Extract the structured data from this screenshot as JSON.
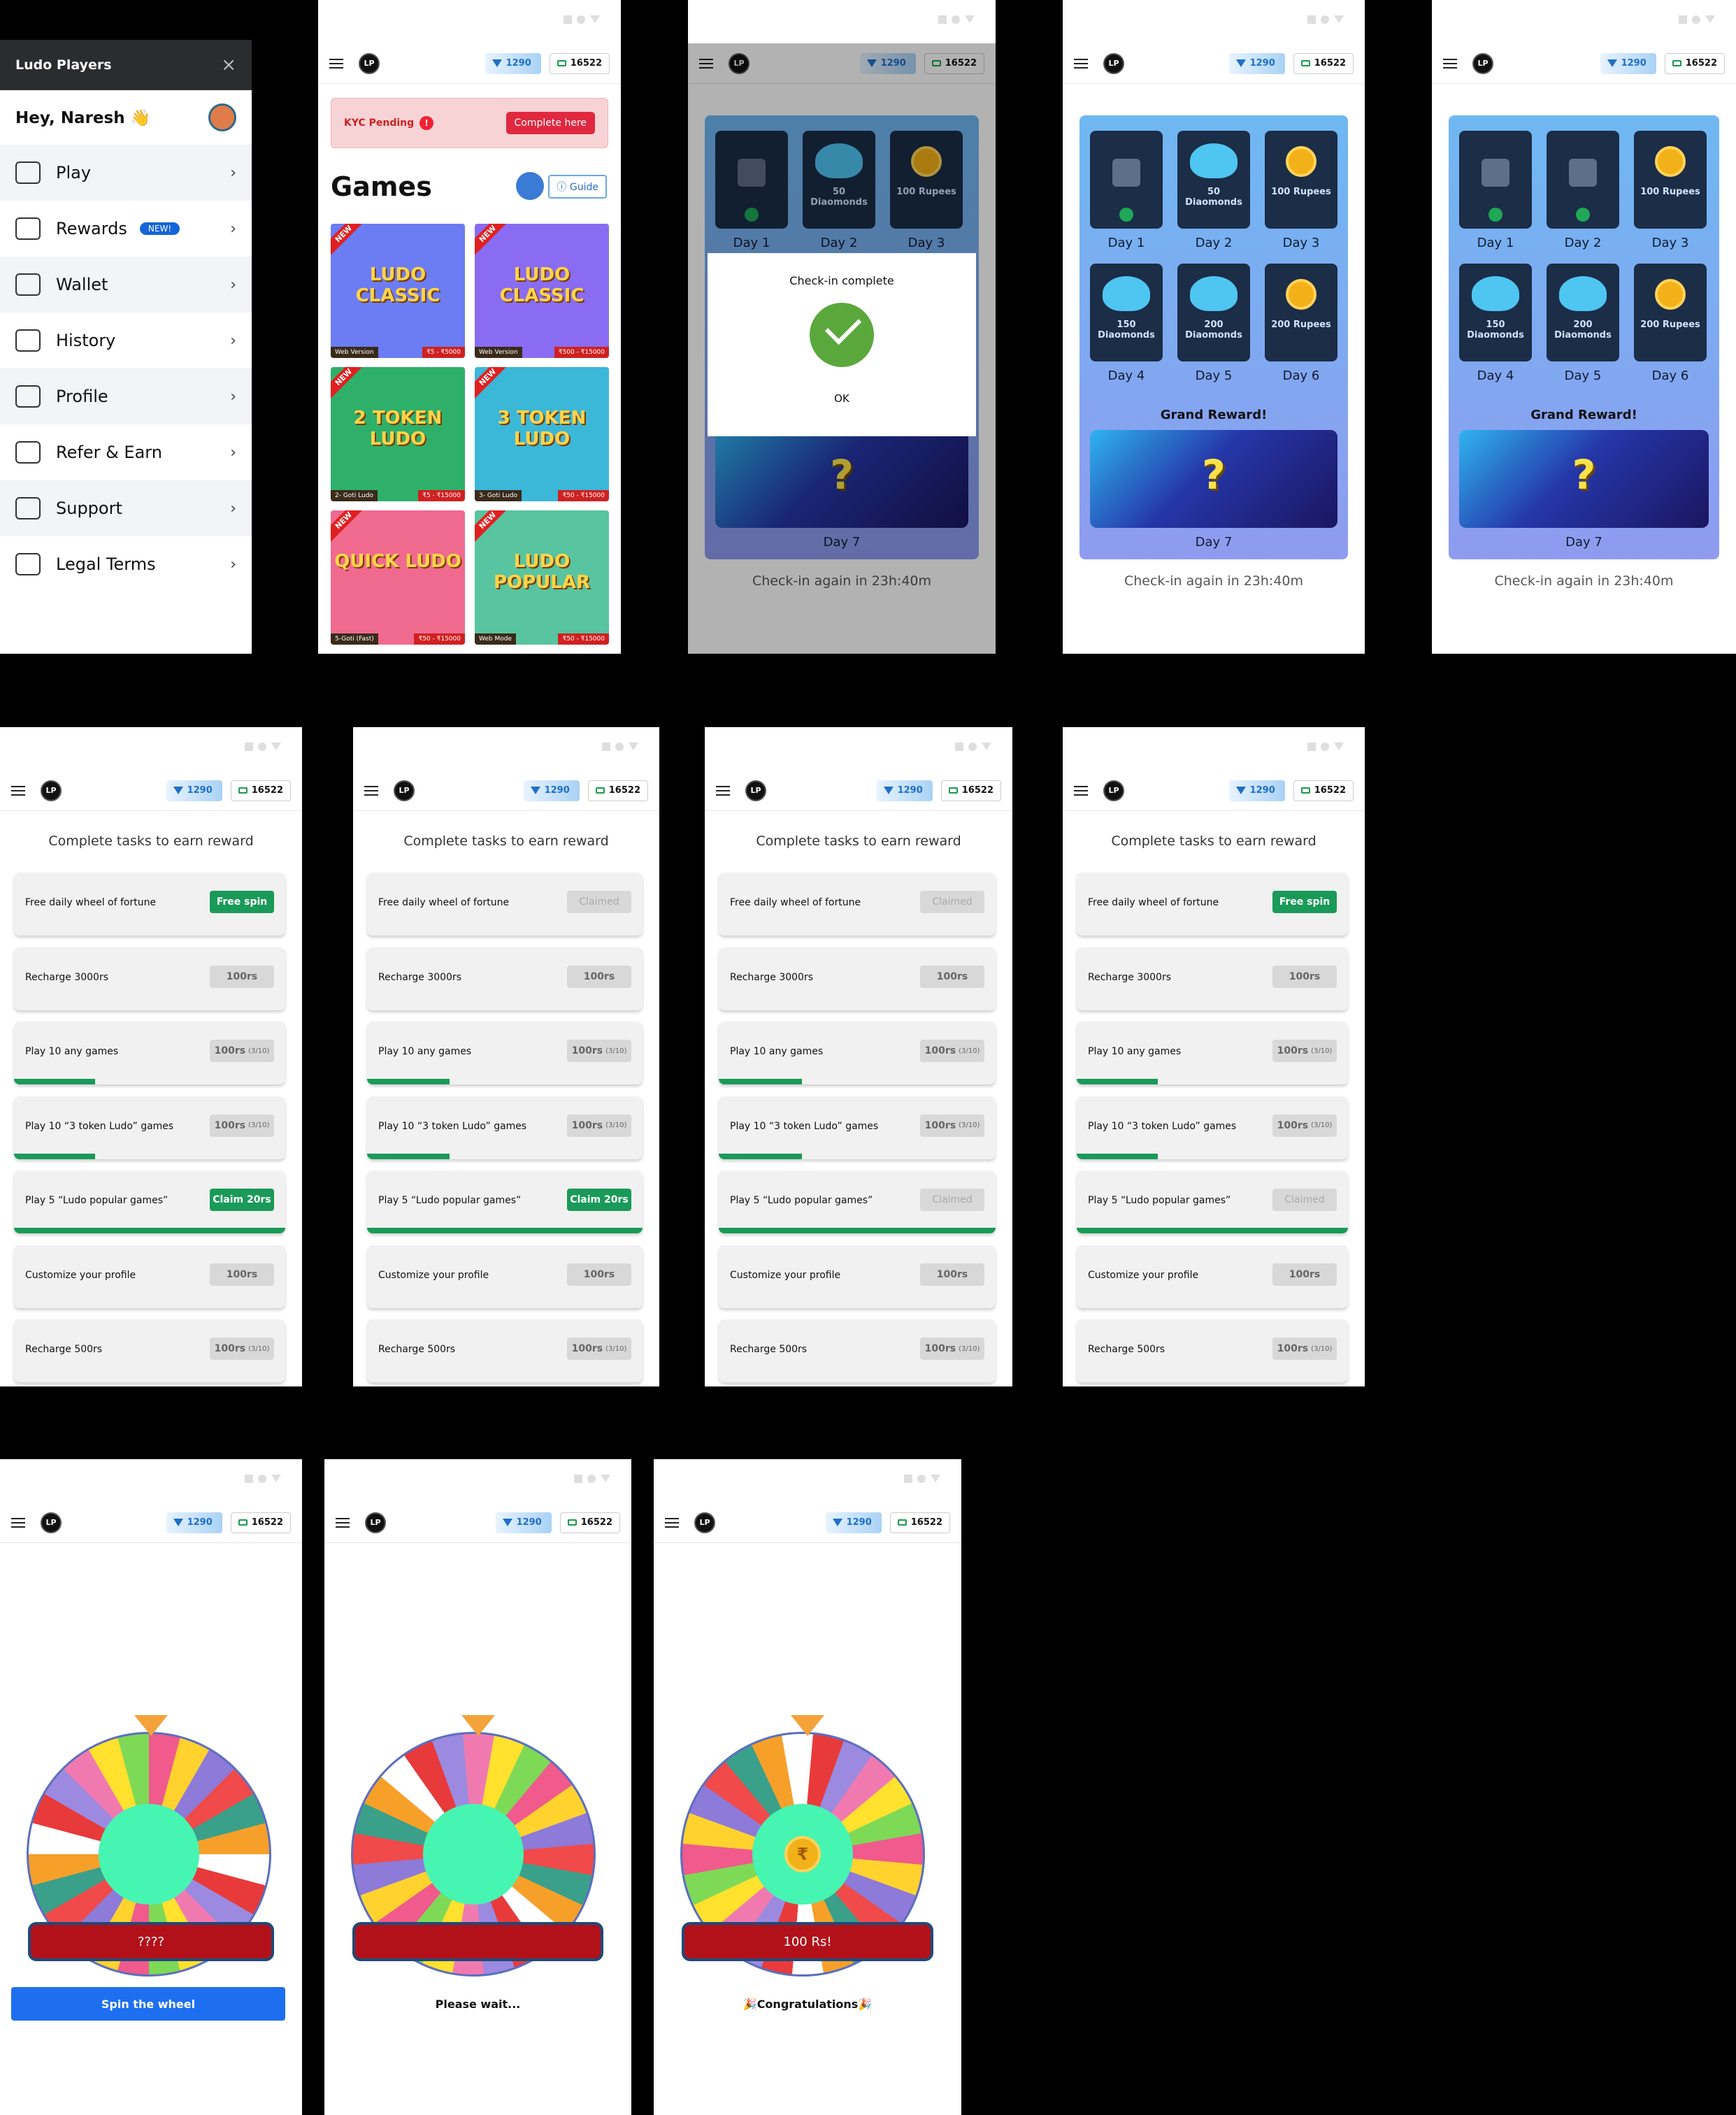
{
  "wallet": {
    "diamonds": "1290",
    "cash": "16522",
    "logo": "LP"
  },
  "drawer": {
    "title": "Ludo Players",
    "close": "×",
    "greeting": "Hey, Naresh",
    "wave": "👋",
    "items": [
      {
        "label": "Play",
        "icon": "dice-icon"
      },
      {
        "label": "Rewards",
        "icon": "gift-icon",
        "badge": "NEW!"
      },
      {
        "label": "Wallet",
        "icon": "wallet-icon"
      },
      {
        "label": "History",
        "icon": "clock-icon"
      },
      {
        "label": "Profile",
        "icon": "user-icon"
      },
      {
        "label": "Refer & Earn",
        "icon": "trophy-icon"
      },
      {
        "label": "Support",
        "icon": "headset-icon"
      },
      {
        "label": "Legal Terms",
        "icon": "document-icon"
      }
    ],
    "chevron": "›"
  },
  "games": {
    "kyc_label": "KYC Pending",
    "kyc_alert": "!",
    "kyc_button": "Complete here",
    "title": "Games",
    "guide": "Guide",
    "new_tag": "NEW",
    "cards": [
      {
        "title": "LUDO CLASSIC",
        "tag": "Web Version",
        "amount": "₹5 - ₹5000",
        "bg": "#6c7cf2"
      },
      {
        "title": "LUDO CLASSIC",
        "tag": "Web Version",
        "amount": "₹500 - ₹15000",
        "bg": "#8a6cf2"
      },
      {
        "title": "2 TOKEN LUDO",
        "tag": "2- Goti Ludo",
        "amount": "₹5 - ₹15000",
        "bg": "#2fb06a"
      },
      {
        "title": "3 TOKEN LUDO",
        "tag": "3- Goti Ludo",
        "amount": "₹50 - ₹15000",
        "bg": "#3bb7d8"
      },
      {
        "title": "QUICK LUDO",
        "tag": "5-Goti (Fast)",
        "amount": "₹50 - ₹15000",
        "bg": "#f06a8f"
      },
      {
        "title": "LUDO POPULAR",
        "tag": "Web Mode",
        "amount": "₹50 - ₹15000",
        "bg": "#58c4a0"
      }
    ]
  },
  "checkin": {
    "modal_title": "Check-in complete",
    "modal_ok": "OK",
    "days": [
      "Day 1",
      "Day 2",
      "Day 3",
      "Day 4",
      "Day 5",
      "Day 6",
      "Day 7"
    ],
    "rewards": [
      "",
      "50 Diaomonds",
      "100 Rupees",
      "150 Diaomonds",
      "200 Diaomonds",
      "200 Rupees"
    ],
    "grand": "Grand Reward!",
    "mystery": "?",
    "again": "Check-in again in 23h:40m"
  },
  "tasks": {
    "title": "Complete tasks to earn reward",
    "labels": [
      "Free daily wheel of fortune",
      "Recharge 3000rs",
      "Play 10 any games",
      "Play 10 “3 token Ludo” games",
      "Play 5 “Ludo popular games”",
      "Customize your profile",
      "Recharge 500rs"
    ],
    "reward": "100rs",
    "progress": "(3/10)",
    "progress_fraction": 0.3,
    "free_spin": "Free spin",
    "claimed": "Claimed",
    "claim": "Claim 20rs"
  },
  "wheel": {
    "result_hidden": "????",
    "result_won": "100 Rs!",
    "spin_button": "Spin the wheel",
    "wait": "Please wait...",
    "congrats": "🎉Congratulations🎉",
    "currency": "₹",
    "colors": [
      "#f05a8c",
      "#ffd22e",
      "#8e7ad8",
      "#f04a4a",
      "#3aa08a",
      "#f6a02a",
      "#ffffff",
      "#e83a3a",
      "#9b8ae0",
      "#f07ab0",
      "#ffe12e",
      "#7ed957"
    ]
  }
}
